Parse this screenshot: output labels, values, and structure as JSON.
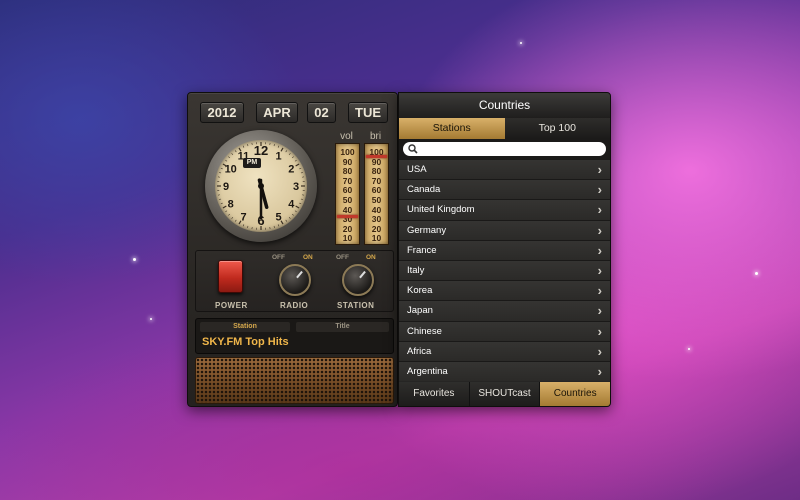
{
  "date": {
    "year": "2012",
    "month": "APR",
    "day": "02",
    "weekday": "TUE"
  },
  "clock": {
    "period": "PM",
    "numbers": [
      "12",
      "1",
      "2",
      "3",
      "4",
      "5",
      "6",
      "7",
      "8",
      "9",
      "10",
      "11"
    ],
    "hour_hand": 5.5,
    "minute_hand": 30
  },
  "meters": {
    "vol_label": "vol",
    "bri_label": "bri",
    "scale": [
      "100",
      "90",
      "80",
      "70",
      "60",
      "50",
      "40",
      "30",
      "20",
      "10"
    ],
    "vol_level": 28,
    "bri_level": 92
  },
  "controls": {
    "power_label": "POWER",
    "radio_label": "RADIO",
    "station_label": "STATION",
    "off_label": "OFF",
    "on_label": "ON"
  },
  "display": {
    "station_tab": "Station",
    "title_tab": "Title",
    "now_playing": "SKY.FM Top Hits"
  },
  "panel": {
    "title": "Countries",
    "segments": [
      "Stations",
      "Top 100"
    ],
    "search_placeholder": "",
    "countries": [
      "USA",
      "Canada",
      "United Kingdom",
      "Germany",
      "France",
      "Italy",
      "Korea",
      "Japan",
      "Chinese",
      "Africa",
      "Argentina"
    ],
    "bottom_tabs": [
      "Favorites",
      "SHOUTcast",
      "Countries"
    ]
  },
  "colors": {
    "accent": "#c49a50",
    "marker": "#c0392b",
    "display_text": "#f0b64a"
  }
}
